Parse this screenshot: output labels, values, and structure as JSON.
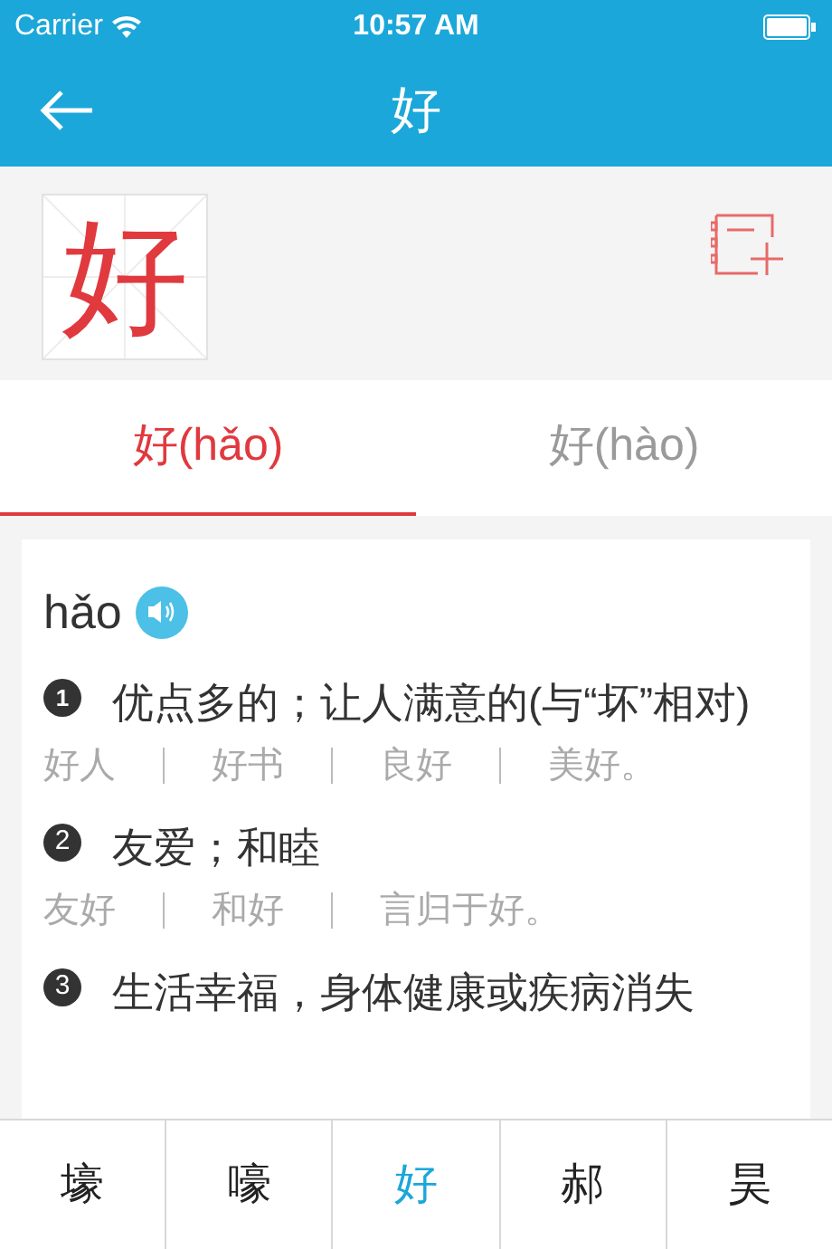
{
  "status_bar": {
    "carrier": "Carrier",
    "time": "10:57 AM"
  },
  "nav": {
    "title": "好"
  },
  "character": {
    "glyph": "好"
  },
  "tabs": [
    {
      "label": "好(hǎo)",
      "selected": true
    },
    {
      "label": "好(hào)",
      "selected": false
    }
  ],
  "entry": {
    "pinyin": "hǎo",
    "definitions": [
      {
        "number": "1",
        "kind": "filled",
        "text": "优点多的；让人满意的(与“坏”相对)",
        "examples": [
          "好人",
          "好书",
          "良好",
          "美好。"
        ]
      },
      {
        "number": "2",
        "kind": "circled",
        "text": "友爱；和睦",
        "examples": [
          "友好",
          "和好",
          "言归于好。"
        ]
      },
      {
        "number": "3",
        "kind": "circled",
        "text": "生活幸福，身体健康或疾病消失"
      }
    ]
  },
  "related": [
    {
      "label": "壕",
      "selected": false
    },
    {
      "label": "嚎",
      "selected": false
    },
    {
      "label": "好",
      "selected": true
    },
    {
      "label": "郝",
      "selected": false
    },
    {
      "label": "昊",
      "selected": false
    }
  ]
}
